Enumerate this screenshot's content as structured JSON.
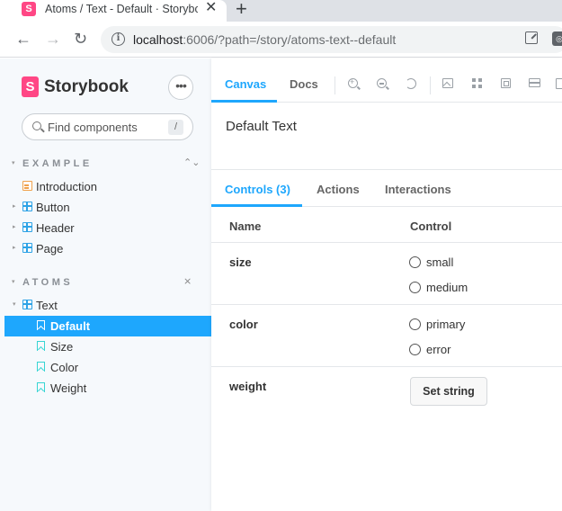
{
  "browser": {
    "tab_title": "Atoms / Text - Default · Storybook",
    "tab_favicon": "S",
    "close_glyph": "✕",
    "new_tab_glyph": "+",
    "url_host": "localhost",
    "url_path": ":6006/?path=/story/atoms-text--default",
    "info_glyph": "i",
    "ext_glyph": "◎",
    "back_glyph": "←",
    "forward_glyph": "→",
    "reload_glyph": "↻"
  },
  "sidebar": {
    "brand_logo": "S",
    "brand_name": "Storybook",
    "menu_glyph": "•••",
    "search_placeholder": "Find components",
    "search_shortcut": "/",
    "sections": [
      {
        "label": "EXAMPLE",
        "toggle_glyph": "⌃⌄",
        "items": [
          {
            "label": "Introduction",
            "type": "doc"
          },
          {
            "label": "Button",
            "type": "component"
          },
          {
            "label": "Header",
            "type": "component"
          },
          {
            "label": "Page",
            "type": "component"
          }
        ]
      },
      {
        "label": "ATOMS",
        "toggle_glyph": "⨯",
        "items": [
          {
            "label": "Text",
            "type": "component",
            "expanded": true
          },
          {
            "label": "Default",
            "type": "story",
            "selected": true
          },
          {
            "label": "Size",
            "type": "story"
          },
          {
            "label": "Color",
            "type": "story"
          },
          {
            "label": "Weight",
            "type": "story"
          }
        ]
      }
    ],
    "caret_collapsed": "▸",
    "caret_expanded": "▾"
  },
  "toolbar": {
    "tabs": [
      {
        "label": "Canvas",
        "active": true
      },
      {
        "label": "Docs",
        "active": false
      }
    ],
    "icons": [
      "zoom-in-icon",
      "zoom-out-icon",
      "reset-zoom-icon",
      "background-icon",
      "grid-icon",
      "outline-icon",
      "measure-icon",
      "viewport-icon"
    ]
  },
  "canvas": {
    "text": "Default Text"
  },
  "addons": {
    "tabs": [
      {
        "label": "Controls (3)",
        "active": true
      },
      {
        "label": "Actions",
        "active": false
      },
      {
        "label": "Interactions",
        "active": false
      }
    ],
    "columns": {
      "name": "Name",
      "control": "Control"
    },
    "rows": [
      {
        "name": "size",
        "options": [
          "small",
          "medium"
        ]
      },
      {
        "name": "color",
        "options": [
          "primary",
          "error"
        ]
      },
      {
        "name": "weight",
        "button": "Set string"
      }
    ]
  },
  "colors": {
    "accent": "#1ea7fd",
    "brand": "#ff4785",
    "sidebar_bg": "#f6f9fc"
  }
}
